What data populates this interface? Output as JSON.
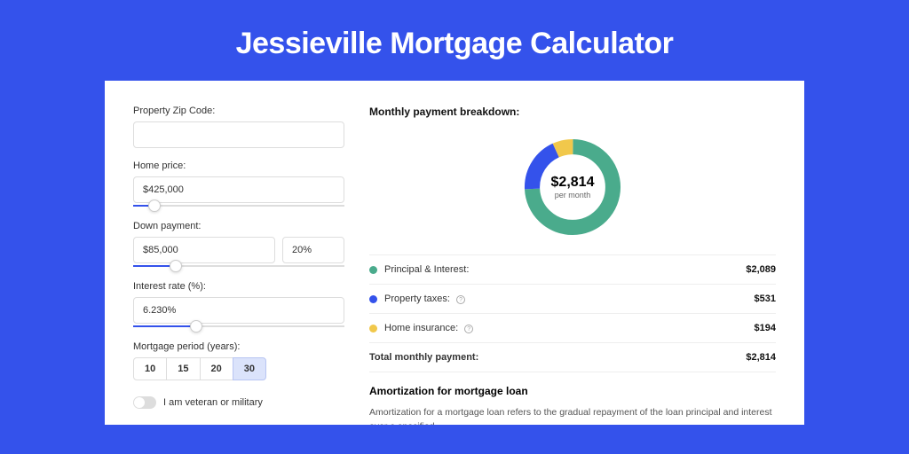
{
  "header": {
    "title": "Jessieville Mortgage Calculator"
  },
  "form": {
    "zip_label": "Property Zip Code:",
    "zip_value": "",
    "home_price_label": "Home price:",
    "home_price_value": "$425,000",
    "home_price_slider_pct": 10,
    "down_payment_label": "Down payment:",
    "down_payment_value": "$85,000",
    "down_payment_pct_value": "20%",
    "down_payment_slider_pct": 20,
    "interest_label": "Interest rate (%):",
    "interest_value": "6.230%",
    "interest_slider_pct": 30,
    "period_label": "Mortgage period (years):",
    "periods": [
      "10",
      "15",
      "20",
      "30"
    ],
    "period_selected": "30",
    "veteran_label": "I am veteran or military"
  },
  "breakdown": {
    "title": "Monthly payment breakdown:",
    "amount": "$2,814",
    "per_month": "per month",
    "rows": [
      {
        "label": "Principal & Interest:",
        "value": "$2,089",
        "color": "#4aab8c",
        "info": false
      },
      {
        "label": "Property taxes:",
        "value": "$531",
        "color": "#3452eb",
        "info": true
      },
      {
        "label": "Home insurance:",
        "value": "$194",
        "color": "#f1c84b",
        "info": true
      }
    ],
    "total_label": "Total monthly payment:",
    "total_value": "$2,814"
  },
  "amortization": {
    "title": "Amortization for mortgage loan",
    "text": "Amortization for a mortgage loan refers to the gradual repayment of the loan principal and interest over a specified"
  },
  "chart_data": {
    "type": "pie",
    "title": "Monthly payment breakdown",
    "series": [
      {
        "name": "Principal & Interest",
        "value": 2089,
        "color": "#4aab8c"
      },
      {
        "name": "Property taxes",
        "value": 531,
        "color": "#3452eb"
      },
      {
        "name": "Home insurance",
        "value": 194,
        "color": "#f1c84b"
      }
    ],
    "total": 2814,
    "center_label": "$2,814 per month"
  }
}
